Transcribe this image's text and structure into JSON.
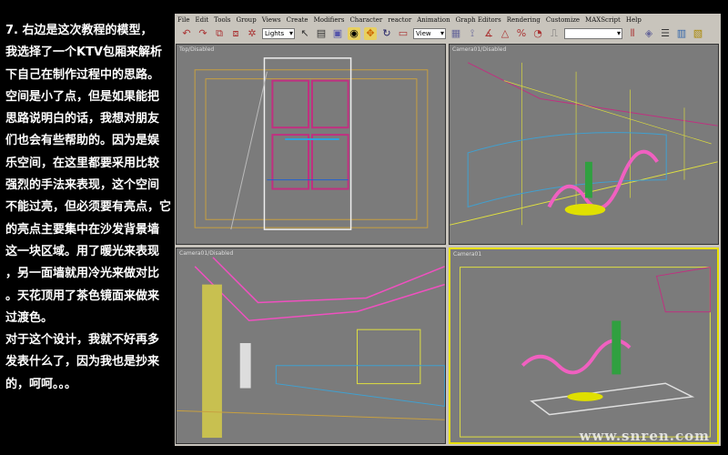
{
  "article": {
    "lines": [
      "7. 右边是这次教程的模型，",
      "我选择了一个KTV包厢来解析",
      "下自己在制作过程中的思路。",
      "空间是小了点，但是如果能把",
      "思路说明白的话，我想对朋友",
      "们也会有些帮助的。因为是娱",
      "乐空间，在这里都要采用比较",
      "强烈的手法来表现，这个空间",
      "不能过亮，但必须要有亮点，它",
      "的亮点主要集中在沙发背景墙",
      "这一块区域。用了暖光来表现",
      "，另一面墙就用冷光来做对比",
      "。天花顶用了茶色镜面来做来",
      "过渡色。",
      "对于这个设计，我就不好再多",
      "发表什么了，因为我也是抄来",
      "的，呵呵。。。"
    ]
  },
  "menu": [
    "File",
    "Edit",
    "Tools",
    "Group",
    "Views",
    "Create",
    "Modifiers",
    "Character",
    "reactor",
    "Animation",
    "Graph Editors",
    "Rendering",
    "Customize",
    "MAXScript",
    "Help"
  ],
  "toolbar": {
    "selection_filter": "Lights",
    "reference_coord": "View",
    "named_selection": ""
  },
  "viewports": [
    {
      "label": "Top/Disabled"
    },
    {
      "label": "Camera01/Disabled"
    },
    {
      "label": "Camera01/Disabled"
    },
    {
      "label": "Camera01"
    }
  ],
  "watermark": "www.snren.com"
}
